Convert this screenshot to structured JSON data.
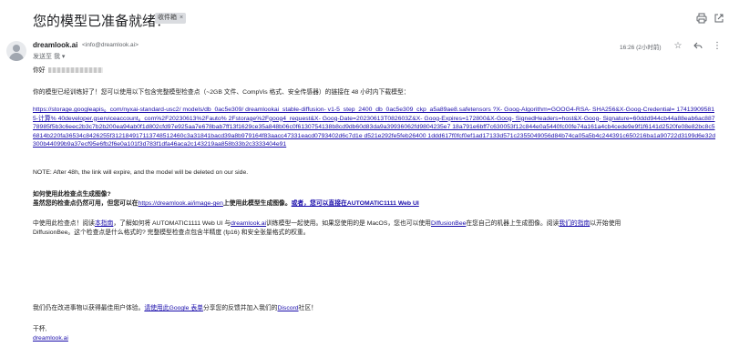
{
  "header": {
    "subject": "您的模型已准备就绪！",
    "label": "收件箱",
    "label_close": "×",
    "print_icon": "printer-icon",
    "popout_icon": "open-in-new-icon"
  },
  "message": {
    "sender_name": "dreamlook.ai",
    "sender_email": "<info@dreamlook.ai>",
    "to_line": "发送至 我 ▾",
    "time": "16:26 (2小时前)",
    "greeting": "你好",
    "intro": "你的模型已经训练好了！您可以使用以下包含完整模型检查点（~2GB 文件、CompVis 格式、安全传感器）的链接在 48 小时内下载模型：",
    "download_link": "https://storage.googleapis。com/nyxai-standard-usc2/ models/db_0ac5e309/ dreamlookai_stable-diffusion- v1-5_step_2400_db_0ac5e309_ckp_a5a89ae8.safetensors ?X- Goog-Algorithm=GOOG4-RSA- SHA256&X-Goog-Credential= 174139095815-计算% 40developer.gserviceaccount。com%2F20230613%2Fauto% 2Fstorage%2Fgoog4_request&X- Goog-Date=20230613T082603Z&X- Goog-Expires=172800&X-Goog- SignedHeaders=host&X-Goog- Signature=60ddd944cb44a88eab6ac88778985f5b3c6eec2b3c7b2b200ea94ab0f1d802cfd97e925aa7e678bab7ff13f1629ce35a848b06c0f6130754138b8cd9db60d83da9a39936062fd9804235e7 18a791e6bff7c630053f12c844e0a5440fc00fe74a161a4cb4cede9e9f1f6141d2520fe08e82bc8c56814b220fa36534c8426255f312184917113748512460c3a31841bacd39a8b979164f83aacc47331eacd0793402d6c7d1e d521e292fe5feb26400 1ddd617f0fcf0ef1ad17133d571c2355049056d84b74ca05a5b4c244391c650216ba1a90722d3199d6e32d300b44099b9a37ecf95e6fb2f6e0a101f3d783f1dfa46aca2c143219aa858b33b2c3333404e91",
    "note": "NOTE: After 48h, the link will expire, and the model will be deleted on our side.",
    "how_to_heading": "如何使用此检查点生成图像?",
    "how_to_prefix": "虽然您的检查点仍然可用，但您可以在",
    "how_to_link1": "https://dreamlook.ai/image-gen",
    "how_to_middle": "上使用此模型生成图像。",
    "how_to_link2": "或者，您可以直接在AUTOMATIC1111 Web UI",
    "p3_part1": "中使用此检查点！阅读",
    "p3_link1": "本指南",
    "p3_part2": "，了解如何将 AUTOMATIC1111 Web UI 与",
    "p3_link2": "dreamlook.ai",
    "p3_part3": "训练模型一起使用。如果您使用的是 MacOS，您也可以使用",
    "p3_link3": "DiffusionBee",
    "p3_part4": "在您自己的机器上生成图像。阅读",
    "p3_link4": "我们的指南",
    "p3_part5": "以开始使用",
    "p3_line2": "DiffusionBee。这个检查点是什么格式的? 完整模型检查点包含半精度 (fp16) 和安全张量格式的权重。",
    "feedback_part1": "我们仍在改进事物以获得最佳用户体验。",
    "feedback_link1": "请使用此Google 表单",
    "feedback_part2": "分享您的反馈并加入我们的",
    "feedback_link2": "Discord",
    "feedback_part3": "社区！",
    "signoff": "干杯,",
    "signature_link": "dreamlook.ai"
  }
}
